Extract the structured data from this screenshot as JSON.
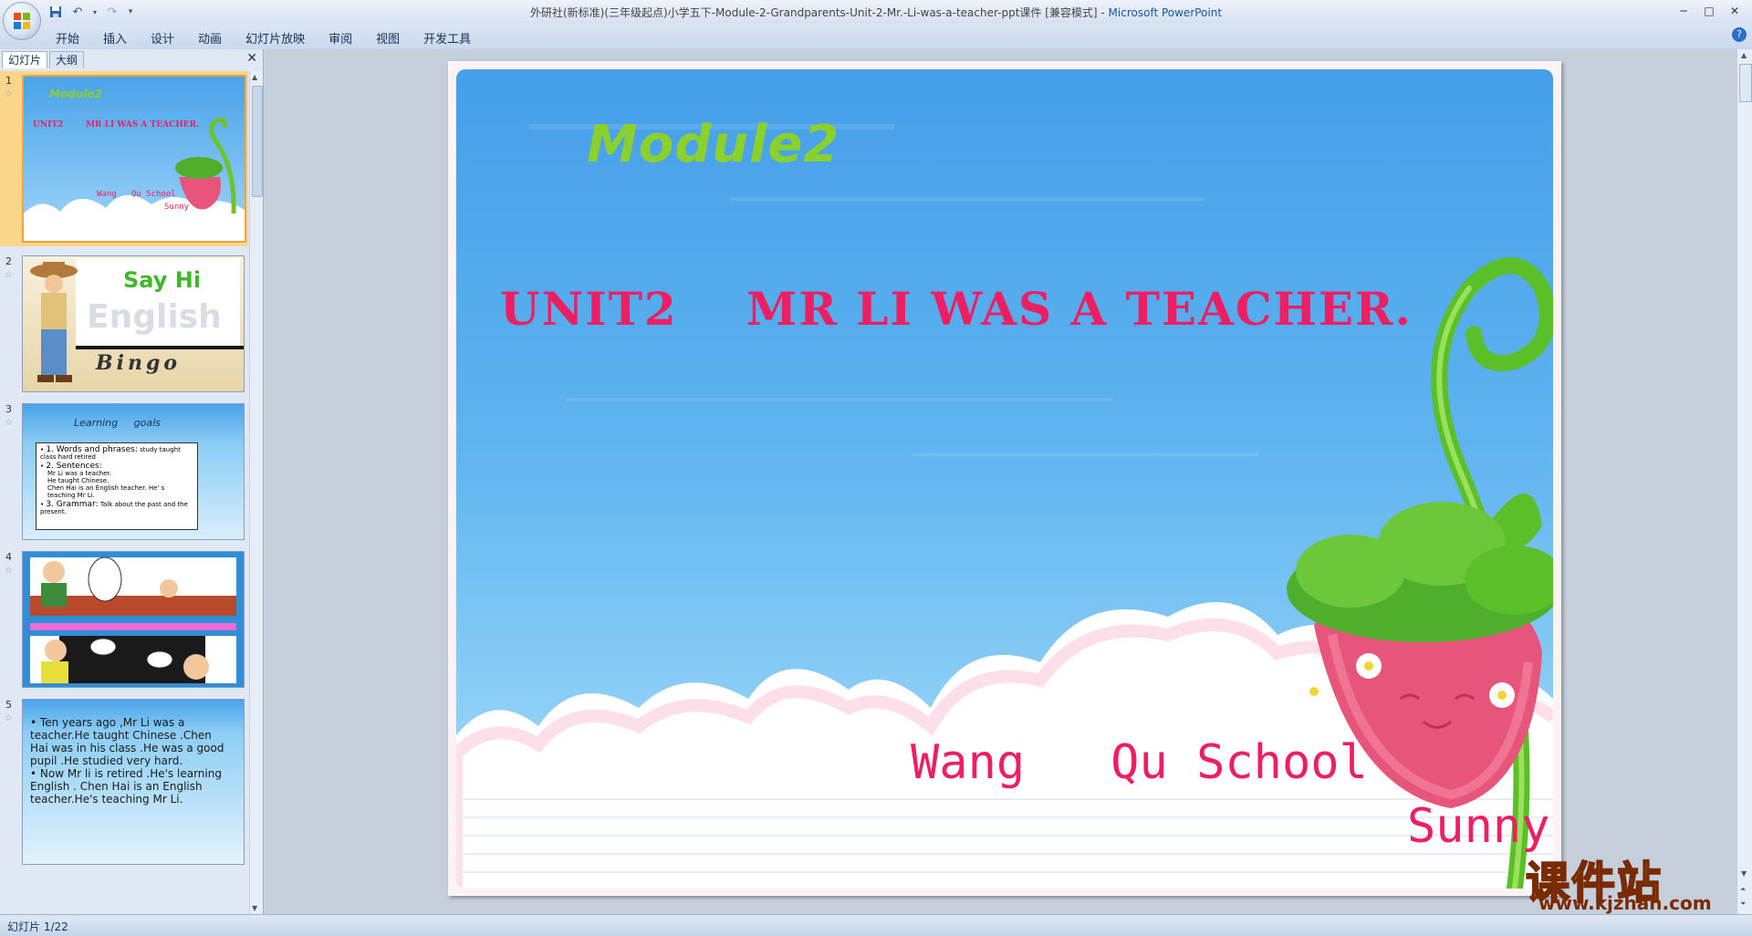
{
  "window": {
    "title_prefix": "外研社(新标准)(三年级起点)小学五下-Module-2-Grandparents-Unit-2-Mr.-Li-was-a-teacher-ppt课件 [兼容模式] - ",
    "app_name": "Microsoft PowerPoint"
  },
  "ribbon": {
    "tabs": [
      "开始",
      "插入",
      "设计",
      "动画",
      "幻灯片放映",
      "审阅",
      "视图",
      "开发工具"
    ]
  },
  "panel": {
    "tab_slides": "幻灯片",
    "tab_outline": "大纲"
  },
  "thumbnails": [
    {
      "num": "1",
      "module": "Module2",
      "unit": "UNIT2",
      "title": "MR LI WAS A TEACHER.",
      "school": "Wang   Qu School",
      "author": "Sunny"
    },
    {
      "num": "2",
      "say_hi": "Say Hi",
      "english": "English",
      "bingo": "Bingo"
    },
    {
      "num": "3",
      "heading": "Learning     goals",
      "b1_head": "1. Words and phrases:",
      "b1_text": "study  taught  class  hard  retired",
      "b2_head": "2. Sentences:",
      "b2_l1": "Mr Li was    a teacher.",
      "b2_l2": "He   taught Chinese.",
      "b2_l3": "Chen Hai is an English teacher. He' s teaching Mr Li.",
      "b3_head": "3. Grammar:",
      "b3_text": "Talk about the past and the present."
    },
    {
      "num": "4"
    },
    {
      "num": "5",
      "line1": "Ten years  ago  ,Mr Li  was  a teacher.He  taught Chinese .Chen Hai was  in his  class  .He  was  a good  pupil .He  studied  very  hard.",
      "line2": "Now  Mr li  is  retired  .He's learning English .  Chen  Hai   is  an English teacher.He's  teaching  Mr  Li."
    }
  ],
  "slide": {
    "module_title": "Module2",
    "unit_label": "UNIT2",
    "lesson_title": "MR LI WAS A TEACHER.",
    "school": "Wang   Qu School",
    "author": "Sunny"
  },
  "status": {
    "slide_counter": "幻灯片 1/22"
  },
  "watermark": {
    "main": "课件站",
    "url": "www.kjzhan.com"
  },
  "colors": {
    "slide_title_pink": "#ee1e63",
    "module_green": "#8cd12b",
    "selection_orange": "#f1a43a"
  }
}
